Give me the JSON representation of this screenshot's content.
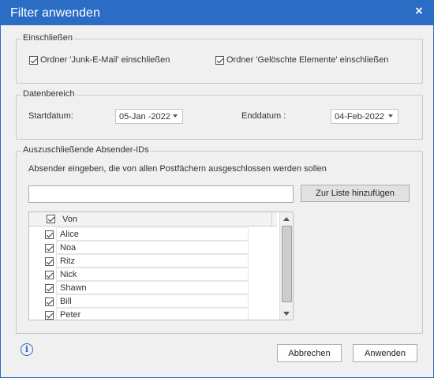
{
  "window": {
    "title": "Filter anwenden",
    "close_glyph": "×"
  },
  "include": {
    "label": "Einschließen",
    "junk_label": "Ordner 'Junk-E-Mail' einschließen",
    "junk_checked": true,
    "deleted_label": "Ordner 'Gelöschte Elemente' einschließen",
    "deleted_checked": true
  },
  "date_range": {
    "label": "Datenbereich",
    "start_label": "Startdatum:",
    "start_value": "05-Jan -2022",
    "end_label": "Enddatum :",
    "end_value": "04-Feb-2022"
  },
  "exclude": {
    "label": "Auszuschließende Absender-IDs",
    "instructions": "Absender eingeben, die von allen Postfächern ausgeschlossen werden sollen",
    "input_value": "",
    "add_button": "Zur Liste hinzufügen",
    "column_header": "Von",
    "senders": [
      {
        "name": "Alice",
        "checked": true
      },
      {
        "name": "Noa",
        "checked": true
      },
      {
        "name": "Ritz",
        "checked": true
      },
      {
        "name": "Nick",
        "checked": true
      },
      {
        "name": "Shawn",
        "checked": true
      },
      {
        "name": "Bill",
        "checked": true
      },
      {
        "name": "Peter",
        "checked": true
      }
    ]
  },
  "footer": {
    "info_icon": "i",
    "cancel_button": "Abbrechen",
    "apply_button": "Anwenden"
  },
  "colors": {
    "accent": "#2b6cc4",
    "background": "#f0f0f0"
  }
}
